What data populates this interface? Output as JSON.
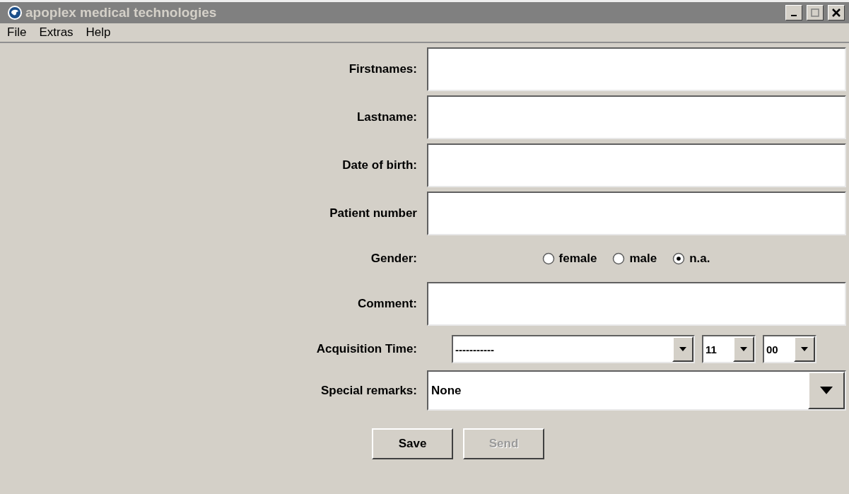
{
  "window": {
    "title": "apoplex medical technologies"
  },
  "menu": [
    "File",
    "Extras",
    "Help"
  ],
  "fields": [
    {
      "kind": "text",
      "label": "Firstnames:"
    },
    {
      "kind": "text",
      "label": "Lastname:"
    },
    {
      "kind": "text",
      "label": "Date of birth:"
    },
    {
      "kind": "text",
      "label": "Patient number"
    },
    {
      "kind": "radio",
      "label": "Gender:",
      "options": [
        {
          "label": "female",
          "selected": false
        },
        {
          "label": "male",
          "selected": false
        },
        {
          "label": "n.a.",
          "selected": true
        }
      ]
    },
    {
      "kind": "text",
      "label": "Comment:"
    },
    {
      "kind": "time",
      "label": "Acquisition Time:",
      "date": "-----------",
      "hour": "11",
      "minute": "00"
    },
    {
      "kind": "select",
      "label": "Special remarks:",
      "value": "None"
    }
  ],
  "buttons": [
    {
      "label": "Save",
      "disabled": false
    },
    {
      "label": "Send",
      "disabled": true
    }
  ]
}
